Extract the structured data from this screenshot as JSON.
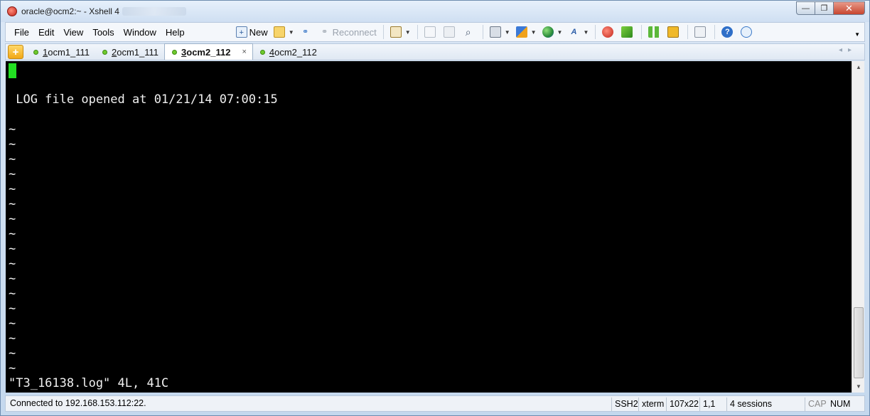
{
  "window": {
    "title": "oracle@ocm2:~ - Xshell 4",
    "controls": {
      "minimize": "—",
      "maximize": "❐",
      "close": "✕"
    }
  },
  "menu": [
    "File",
    "Edit",
    "View",
    "Tools",
    "Window",
    "Help"
  ],
  "toolbar": {
    "new_label": "New",
    "reconnect_label": "Reconnect"
  },
  "tabs": [
    {
      "num": "1",
      "label": " ocm1_111",
      "active": false
    },
    {
      "num": "2",
      "label": " ocm1_111",
      "active": false
    },
    {
      "num": "3",
      "label": " ocm2_112",
      "active": true
    },
    {
      "num": "4",
      "label": " ocm2_112",
      "active": false
    }
  ],
  "tab_close": "×",
  "terminal": {
    "log_line": " LOG file opened at 01/21/14 07:00:15",
    "tilde": "~",
    "tilde_count": 17,
    "status_line": "\"T3_16138.log\" 4L, 41C"
  },
  "statusbar": {
    "connection": "Connected to 192.168.153.112:22.",
    "protocol": "SSH2",
    "term_type": "xterm",
    "size": "107x22",
    "cursor_pos": "1,1",
    "sessions": "4 sessions",
    "cap": "CAP",
    "num": "NUM"
  }
}
